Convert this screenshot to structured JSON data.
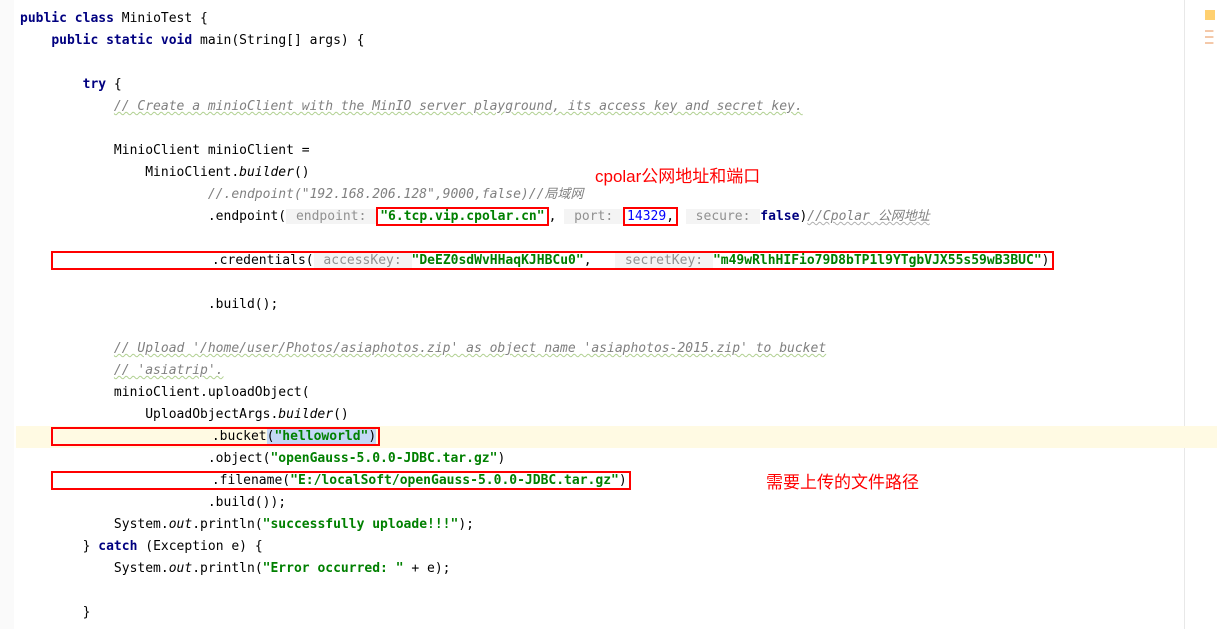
{
  "code": {
    "class_decl_pub": "public",
    "class_decl_cls": "class",
    "class_name": "MinioTest",
    "main_pub": "public",
    "main_static": "static",
    "main_void": "void",
    "main_sig": "main(String[] args) {",
    "try_kw": "try",
    "comment_create": "// Create a minioClient with the MinIO server playground, its access key and secret key.",
    "var_decl": "MinioClient minioClient =",
    "builder_call": "            MinioClient.",
    "builder_method": "builder",
    "builder_paren": "()",
    "endpoint_comment_line": "                    //.endpoint(\"192.168.206.128\",9000,false)",
    "endpoint_comment_suffix": "//局域网",
    "endpoint_call": "                    .endpoint(",
    "hint_endpoint": " endpoint: ",
    "endpoint_value": "\"6.tcp.vip.cpolar.cn\"",
    "comma1": ",",
    "hint_port": " port: ",
    "port_value": "14329",
    "comma2": ",",
    "hint_secure": " secure: ",
    "secure_value": "false",
    "endpoint_close": ")",
    "cpolar_comment": "//Cpolar 公网地址",
    "creds_call": "                    .credentials(",
    "hint_access": " accessKey: ",
    "access_value": "\"DeEZ0sdWvHHaqKJHBCu0\"",
    "comma3": ",   ",
    "hint_secret": " secretKey: ",
    "secret_value": "\"m49wRlhHIFio79D8bTP1l9YTgbVJX55s59wB3BUC\"",
    "creds_close": ")",
    "build1": "                    .build();",
    "comment_upload1": "// Upload '/home/user/Photos/asiaphotos.zip' as object name 'asiaphotos-2015.zip' to bucket",
    "comment_upload2": "// 'asiatrip'.",
    "upload_call": "minioClient.uploadObject(",
    "upload_args": "            UploadObjectArgs.",
    "upload_builder": "builder",
    "upload_paren": "()",
    "bucket_call": "                    .bucket",
    "bucket_paren_open": "(",
    "bucket_value": "\"helloworld\"",
    "bucket_paren_close": ")",
    "object_call": "                    .object(",
    "object_value": "\"openGauss-5.0.0-JDBC.tar.gz\"",
    "object_close": ")",
    "filename_call": "                    .filename(",
    "filename_value": "\"E:/localSoft/openGauss-5.0.0-JDBC.tar.gz\"",
    "filename_close": ")",
    "build2": "                    .build());",
    "sys1_pre": "System.",
    "sys1_out": "out",
    "sys1_print": ".println(",
    "sys1_msg": "\"successfully uploade!!!\"",
    "sys1_close": ");",
    "catch_close_try": "}",
    "catch_kw": "catch",
    "catch_sig": " (Exception e) {",
    "sys2_pre": "System.",
    "sys2_out": "out",
    "sys2_print": ".println(",
    "sys2_msg": "\"Error occurred: \"",
    "sys2_plus": " + e);",
    "final_brace": "}"
  },
  "annotations": {
    "top": "cpolar公网地址和端口",
    "bottom": "需要上传的文件路径"
  }
}
